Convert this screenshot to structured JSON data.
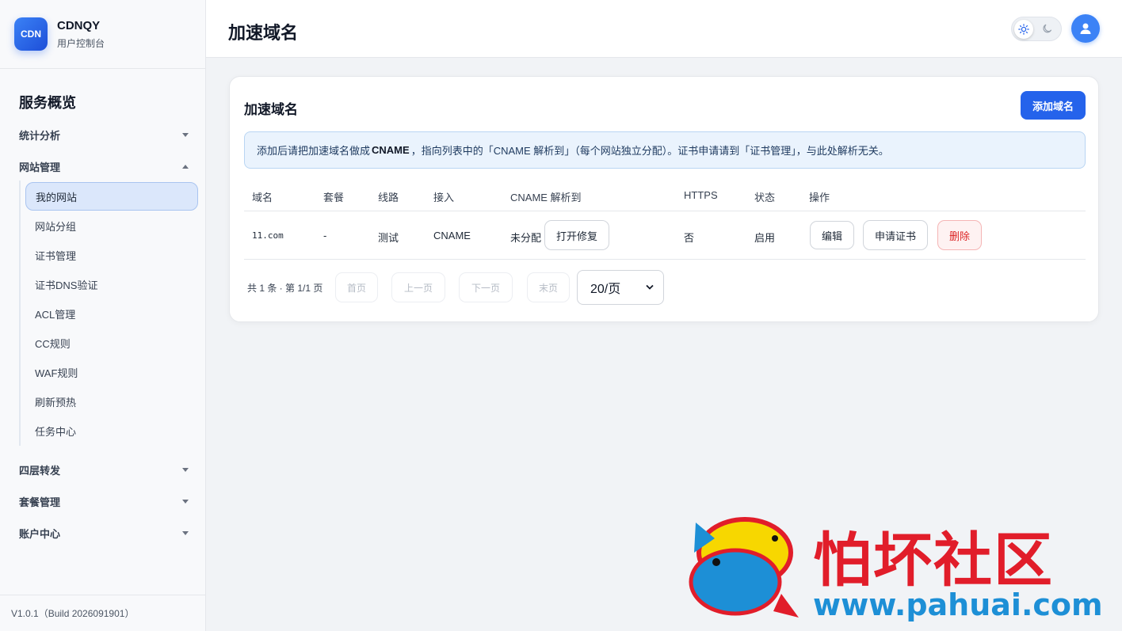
{
  "brand": {
    "logo_text": "CDN",
    "name": "CDNQY",
    "subtitle": "用户控制台"
  },
  "sidebar": {
    "title": "服务概览",
    "groups": [
      {
        "label": "统计分析",
        "expanded": false
      },
      {
        "label": "网站管理",
        "expanded": true
      },
      {
        "label": "四层转发",
        "expanded": false
      },
      {
        "label": "套餐管理",
        "expanded": false
      },
      {
        "label": "账户中心",
        "expanded": false
      }
    ],
    "items": [
      "我的网站",
      "网站分组",
      "证书管理",
      "证书DNS验证",
      "ACL管理",
      "CC规则",
      "WAF规则",
      "刷新预热",
      "任务中心"
    ],
    "active_item": "我的网站"
  },
  "version": "V1.0.1（Build 2026091901）",
  "header": {
    "title": "加速域名"
  },
  "card": {
    "title": "加速域名",
    "add_button": "添加域名",
    "notice": {
      "prefix": "添加后请把加速域名做成",
      "bold": "CNAME",
      "suffix": "，指向列表中的「CNAME 解析到」（每个网站独立分配）。证书申请请到「证书管理」，与此处解析无关。"
    },
    "columns": [
      "域名",
      "套餐",
      "线路",
      "接入",
      "CNAME 解析到",
      "HTTPS",
      "状态",
      "操作"
    ],
    "rows": [
      {
        "domain": "11.com",
        "plan": "-",
        "line": "测试",
        "access": "CNAME",
        "cname": "未分配",
        "cname_action": "打开修复",
        "https": "否",
        "status": "启用",
        "actions": {
          "edit": "编辑",
          "cert": "申请证书",
          "delete": "删除"
        }
      }
    ],
    "pagination": {
      "info": "共 1 条 · 第 1/1 页",
      "first": "首页",
      "prev": "上一页",
      "next": "下一页",
      "last": "末页",
      "page_size": "20/页"
    }
  },
  "watermark": {
    "text": "怕坏社区",
    "url": "www.pahuai.com"
  },
  "colors": {
    "accent": "#2563eb",
    "danger": "#dc2626",
    "notice_bg": "#eaf3fd"
  }
}
